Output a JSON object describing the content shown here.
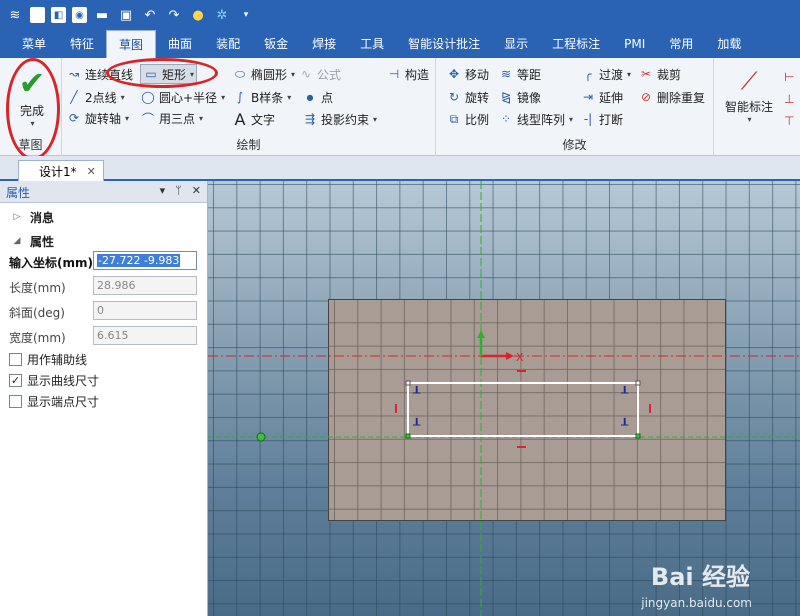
{
  "quick_access": {
    "icons": [
      "app-menu-icon",
      "new-file-icon",
      "open-icon",
      "save-icon",
      "undo-icon",
      "redo-icon",
      "lightbulb-icon",
      "customize-icon"
    ]
  },
  "tabs": [
    {
      "label": "菜单"
    },
    {
      "label": "特征"
    },
    {
      "label": "草图",
      "active": true
    },
    {
      "label": "曲面"
    },
    {
      "label": "装配"
    },
    {
      "label": "钣金"
    },
    {
      "label": "焊接"
    },
    {
      "label": "工具"
    },
    {
      "label": "智能设计批注"
    },
    {
      "label": "显示"
    },
    {
      "label": "工程标注"
    },
    {
      "label": "PMI"
    },
    {
      "label": "常用"
    },
    {
      "label": "加载"
    }
  ],
  "ribbon": {
    "sketch_group": {
      "done_label": "完成",
      "group_label": "草图"
    },
    "draw_group": {
      "group_label": "绘制",
      "connected_line": "连续直线",
      "two_point_line": "2点线",
      "rotate_axis": "旋转轴",
      "rectangle": "矩形",
      "center_radius": "圆心+半径",
      "three_point": "用三点",
      "ellipse": "椭圆形",
      "bspline": "B样条",
      "text": "文字",
      "formula": "公式",
      "point": "点",
      "projection_constraint": "投影约束",
      "construct": "构造"
    },
    "modify_group": {
      "group_label": "修改",
      "move": "移动",
      "rotate": "旋转",
      "scale": "比例",
      "equal_distance": "等距",
      "mirror": "镜像",
      "linear_array": "线型阵列",
      "transition": "过渡",
      "extend": "延伸",
      "break": "打断",
      "trim": "裁剪",
      "delete_duplicate": "删除重复"
    },
    "smart_dimension": "智能标注"
  },
  "document_tab": {
    "label": "设计1*"
  },
  "property_panel": {
    "title": "属性",
    "message_section": "消息",
    "property_section": "属性",
    "fields": [
      {
        "label": "输入坐标(mm)",
        "value": "-27.722 -9.983",
        "active": true
      },
      {
        "label": "长度(mm)",
        "value": "28.986"
      },
      {
        "label": "斜面(deg)",
        "value": "0"
      },
      {
        "label": "宽度(mm)",
        "value": "6.615"
      }
    ],
    "checkboxes": [
      {
        "label": "用作辅助线",
        "checked": false
      },
      {
        "label": "显示曲线尺寸",
        "checked": true
      },
      {
        "label": "显示端点尺寸",
        "checked": false
      }
    ]
  },
  "canvas": {
    "axis_label": "X",
    "watermark": "Bai 经验",
    "watermark_url": "jingyan.baidu.com"
  },
  "colors": {
    "ribbon_blue": "#2a63b4",
    "highlight_red": "#d8242b",
    "done_green": "#2b9a2f",
    "plate": "#a99c95"
  }
}
